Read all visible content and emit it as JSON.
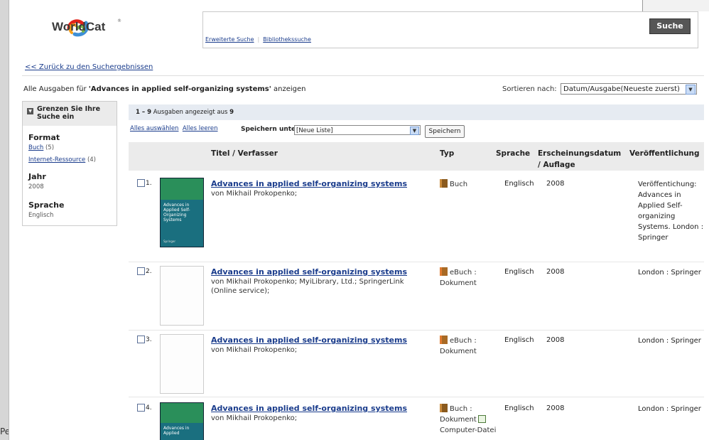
{
  "header": {
    "logo_text": "WorldCat",
    "logo_reg": "®",
    "search_value": "",
    "search_button": "Suche",
    "advanced_search": "Erweiterte Suche",
    "library_search": "Bibliothekssuche"
  },
  "nav": {
    "back_link": "<< Zurück zu den Suchergebnissen"
  },
  "editions_line": {
    "prefix": "Alle Ausgaben für ",
    "query": "'Advances in applied self-organizing systems'",
    "suffix": " anzeigen"
  },
  "sort": {
    "label": "Sortieren nach:",
    "selected": "Datum/Ausgabe(Neueste zuerst)"
  },
  "sidebar": {
    "heading": "Grenzen Sie Ihre Suche ein",
    "format_title": "Format",
    "format_items": [
      {
        "label": "Buch",
        "count": "(5)"
      },
      {
        "label": "Internet-Ressource",
        "count": "(4)"
      }
    ],
    "year_title": "Jahr",
    "year_value": "2008",
    "language_title": "Sprache",
    "language_value": "Englisch"
  },
  "results": {
    "count_range": "1 – 9",
    "count_mid": " Ausgaben angezeigt aus ",
    "count_total": "9",
    "select_all": "Alles auswählen",
    "clear_all": "Alles leeren",
    "save_label": "Speichern unter:",
    "save_selected": "[Neue Liste]",
    "save_button": "Speichern",
    "columns": {
      "title": "Titel / Verfasser",
      "type": "Typ",
      "language": "Sprache",
      "date_line1": "Erscheinungsdatum",
      "date_line2": "/ Auflage",
      "publication": "Veröffentlichung"
    },
    "rows": [
      {
        "num": "1.",
        "title": "Advances in applied self-organizing systems",
        "author": "von Mikhail Prokopenko;",
        "type_line1": "Buch",
        "type_line2": "",
        "type_line3": "",
        "language": "Englisch",
        "year": "2008",
        "publication": "Veröffentichung: Advances in Applied Self-organizing Systems. London : Springer",
        "cover_text": "Advances in Applied Self-Organizing Systems",
        "cover_small": "Springer"
      },
      {
        "num": "2.",
        "title": "Advances in applied self-organizing systems",
        "author": "von Mikhail Prokopenko; MyiLibrary, Ltd.; SpringerLink (Online service);",
        "type_line1": "eBuch :",
        "type_line2": "Dokument",
        "type_line3": "",
        "language": "Englisch",
        "year": "2008",
        "publication": "London : Springer"
      },
      {
        "num": "3.",
        "title": "Advances in applied self-organizing systems",
        "author": "von Mikhail Prokopenko;",
        "type_line1": "eBuch :",
        "type_line2": "Dokument",
        "type_line3": "",
        "language": "Englisch",
        "year": "2008",
        "publication": "London : Springer"
      },
      {
        "num": "4.",
        "title": "Advances in applied self-organizing systems",
        "author": "von Mikhail Prokopenko;",
        "type_line1": "Buch :",
        "type_line2": "Dokument",
        "type_line3": "Computer-Datei",
        "language": "Englisch",
        "year": "2008",
        "publication": "London : Springer",
        "cover_text": "Advances in Applied"
      }
    ]
  },
  "background": {
    "bottom_text": "Pe"
  },
  "colors": {
    "link": "#1a3c8c",
    "header_bar": "#e6ebf2",
    "search_button": "#565656"
  }
}
